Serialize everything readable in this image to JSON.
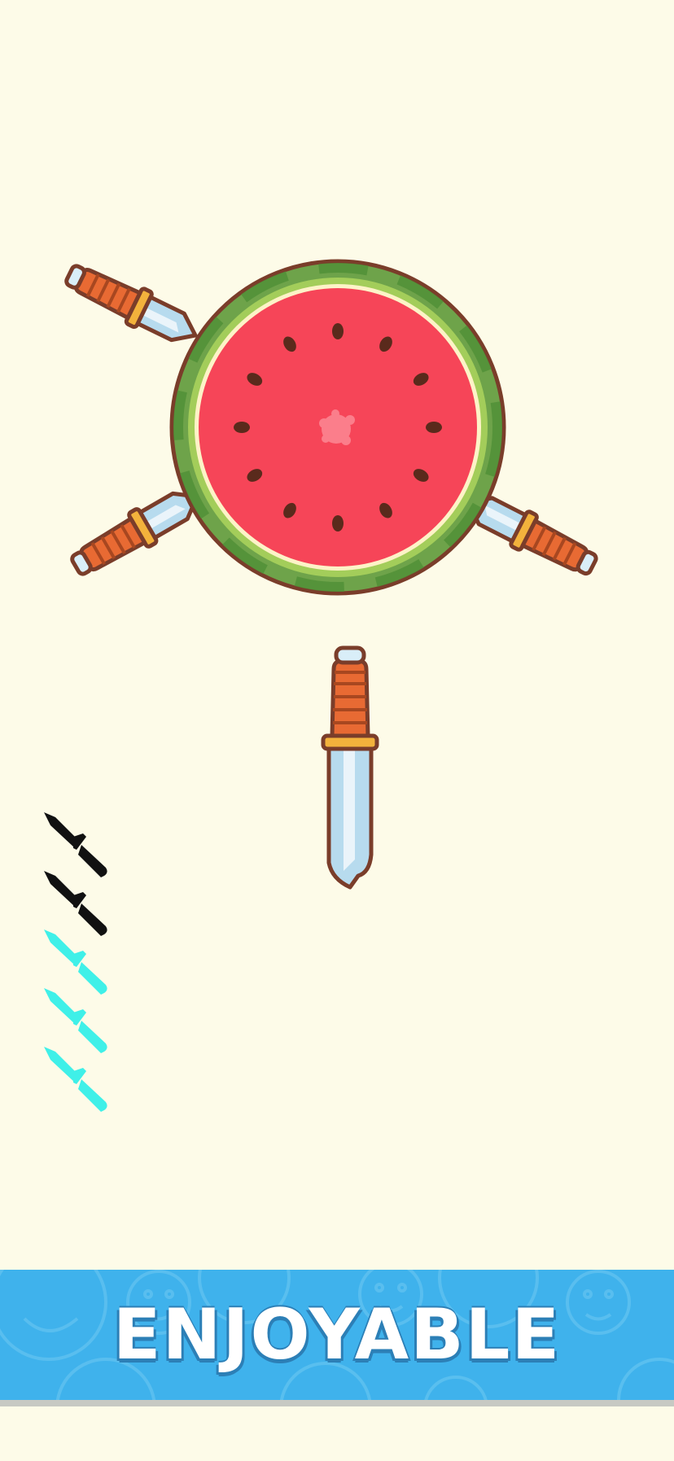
{
  "game": {
    "background_color": "#fdfbe8",
    "target": {
      "name": "watermelon",
      "rind_color": "#6ea34a",
      "flesh_color": "#f64558",
      "seed_color": "#5a2a1c",
      "seed_count": 12
    },
    "stuck_knives_count": 3,
    "knives_remaining": {
      "used_count": 2,
      "available_count": 3,
      "used_color": "#111111",
      "available_color": "#3ff0e8"
    },
    "player_knife": {
      "icon": "knife-icon",
      "blade_color": "#b7dbee",
      "handle_color": "#e86a33",
      "guard_color": "#f3b23c"
    }
  },
  "banner": {
    "text": "ENJOYABLE",
    "background_color": "#3fb2ec",
    "text_color": "#ffffff",
    "pattern_icon": "monkey-face-icon"
  }
}
